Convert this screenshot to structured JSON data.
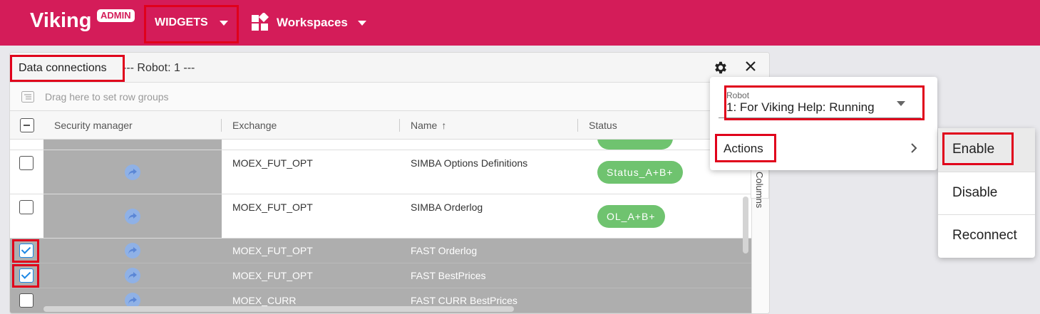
{
  "app": {
    "brand": "Viking",
    "badge": "ADMIN",
    "nav_widgets": "WIDGETS",
    "nav_workspaces": "Workspaces"
  },
  "panel": {
    "title": "Data connections",
    "subtitle": "--- Robot: 1 ---",
    "row_group_hint": "Drag here to set row groups",
    "side_tab_label": "Columns"
  },
  "grid": {
    "columns": [
      "Security manager",
      "Exchange",
      "Name",
      "Status"
    ],
    "sort_indicator": "↑",
    "rows": [
      {
        "exchange": "MOEX_FUT_OPT",
        "name": "SIMBA Options Definitions",
        "status": "Status_A+B+",
        "checked": false,
        "selected": false
      },
      {
        "exchange": "MOEX_FUT_OPT",
        "name": "SIMBA Orderlog",
        "status": "OL_A+B+",
        "checked": false,
        "selected": false
      },
      {
        "exchange": "MOEX_FUT_OPT",
        "name": "FAST Orderlog",
        "status": "",
        "checked": true,
        "selected": true
      },
      {
        "exchange": "MOEX_FUT_OPT",
        "name": "FAST BestPrices",
        "status": "",
        "checked": true,
        "selected": true
      },
      {
        "exchange": "MOEX_CURR",
        "name": "FAST CURR BestPrices",
        "status": "",
        "checked": false,
        "selected": true
      }
    ]
  },
  "settings_menu": {
    "robot_label": "Robot",
    "robot_value": "1: For Viking Help: Running",
    "actions_label": "Actions"
  },
  "actions_menu": {
    "items": [
      "Enable",
      "Disable",
      "Reconnect"
    ]
  },
  "colors": {
    "brand": "#d41c59",
    "status_pill": "#6fc36f",
    "highlight": "#e0001b",
    "selected_row": "#aeaeae"
  }
}
